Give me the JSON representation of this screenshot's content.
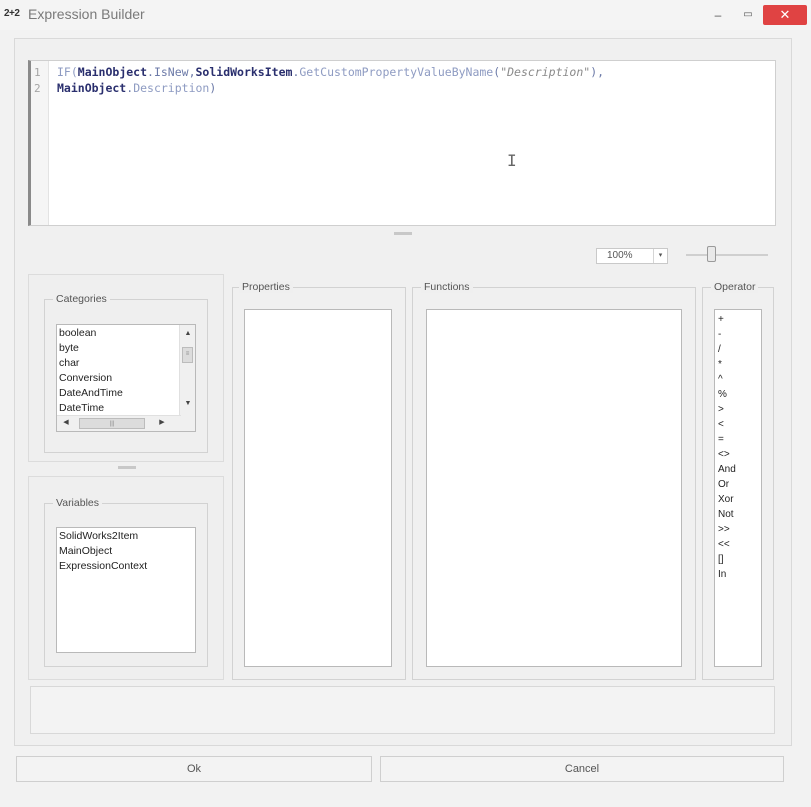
{
  "window": {
    "icon": "2+2",
    "title": "Expression Builder",
    "minimize_glyph": "–",
    "maximize_glyph": "▭",
    "close_glyph": "✕"
  },
  "editor": {
    "line_numbers": [
      "1",
      "2"
    ],
    "line1": {
      "p1": "IF(",
      "p2": "MainObject",
      "p3": ".IsNew,",
      "p4": "SolidWorksItem",
      "p5": ".",
      "p6": "GetCustomPropertyValueByName",
      "p7": "(",
      "p8": "\"Description\"",
      "p9": "),"
    },
    "line2": {
      "p1": "MainObject",
      "p2": ".",
      "p3": "Description",
      "p4": ")"
    },
    "caret_glyph": "I"
  },
  "zoom": {
    "value": "100%",
    "arrow_glyph": "▾",
    "slider_level": 0.3
  },
  "categories": {
    "label": "Categories",
    "items": [
      "boolean",
      "byte",
      "char",
      "Conversion",
      "DateAndTime",
      "DateTime"
    ]
  },
  "variables": {
    "label": "Variables",
    "items": [
      "SolidWorks2Item",
      "MainObject",
      "ExpressionContext"
    ]
  },
  "properties": {
    "label": "Properties"
  },
  "functions": {
    "label": "Functions"
  },
  "operators": {
    "label": "Operator",
    "items": [
      "+",
      "-",
      "/",
      "*",
      "^",
      "%",
      ">",
      "<",
      "=",
      "<>",
      "And",
      "Or",
      "Xor",
      "Not",
      ">>",
      "<<",
      "[]",
      "In"
    ]
  },
  "scroll_glyphs": {
    "up": "▲",
    "down": "▼",
    "left": "◀",
    "right": "▶",
    "grip": "≡",
    "grip_h": "|||"
  },
  "buttons": {
    "ok": "Ok",
    "cancel": "Cancel"
  },
  "colors": {
    "close_button": "#e04343",
    "code_bold": "#2a2f6e",
    "code_light": "#8e9bc2"
  }
}
